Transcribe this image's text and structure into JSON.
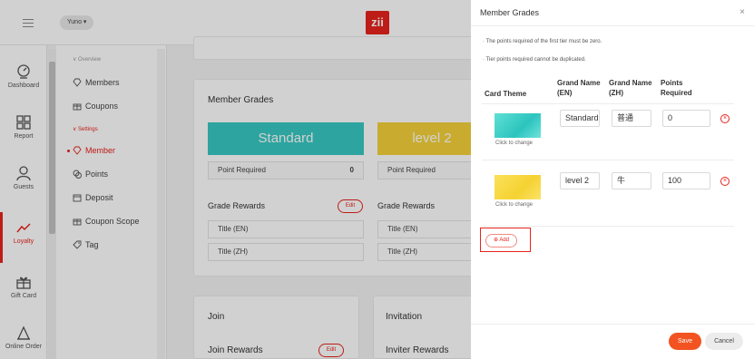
{
  "app": {
    "user_menu": "Yuno ▾",
    "logo": "zii",
    "leftnav": [
      {
        "label": "Dashboard",
        "icon": "dashboard-icon"
      },
      {
        "label": "Report",
        "icon": "report-icon"
      },
      {
        "label": "Guests",
        "icon": "guests-icon"
      },
      {
        "label": "Loyalty",
        "icon": "loyalty-icon",
        "active": true
      },
      {
        "label": "Gift Card",
        "icon": "gift-card-icon"
      },
      {
        "label": "Online Order",
        "icon": "online-order-icon"
      }
    ],
    "subnav": {
      "group_overview": "∨ Overview",
      "group_settings": "∨ Settings",
      "items": [
        {
          "label": "Members",
          "icon": "diamond-icon"
        },
        {
          "label": "Coupons",
          "icon": "gift-icon"
        },
        {
          "label": "Member",
          "icon": "diamond-icon",
          "active": true
        },
        {
          "label": "Points",
          "icon": "points-icon"
        },
        {
          "label": "Deposit",
          "icon": "wallet-icon"
        },
        {
          "label": "Coupon Scope",
          "icon": "gift-icon"
        },
        {
          "label": "Tag",
          "icon": "tag-icon"
        }
      ]
    },
    "member_grades": {
      "title": "Member Grades",
      "tiers": [
        {
          "name": "Standard",
          "point_label": "Point Required",
          "points": "0"
        },
        {
          "name": "level 2",
          "point_label": "Point Required",
          "points": ""
        }
      ],
      "grade_rewards": "Grade Rewards",
      "edit": "Edit",
      "title_en": "Title (EN)",
      "title_zh": "Title (ZH)"
    },
    "join": {
      "title": "Join",
      "rewards": "Join Rewards",
      "edit": "Edit"
    },
    "invitation": {
      "title": "Invitation",
      "rewards": "Inviter Rewards"
    }
  },
  "drawer": {
    "title": "Member Grades",
    "close": "×",
    "notes": [
      "· The points required of the first tier must be zero.",
      "· Tier points required cannot be duplicated."
    ],
    "columns": {
      "card_theme": "Card Theme",
      "grand_name_en": "Grand Name (EN)",
      "grand_name_zh": "Grand Name (ZH)",
      "points_required": "Points Required"
    },
    "rows": [
      {
        "theme": "teal",
        "click_label": "Click to change",
        "name_en": "Standard",
        "name_zh": "普通",
        "points": "0"
      },
      {
        "theme": "yellow",
        "click_label": "Click to change",
        "name_en": "level 2",
        "name_zh": "牛",
        "points": "100"
      }
    ],
    "add_label": "⊕ Add",
    "save_label": "Save",
    "cancel_label": "Cancel",
    "colors": {
      "accent": "#e8231b",
      "save": "#f25320",
      "teal": "#38c9c2",
      "yellow": "#f6d23a"
    }
  }
}
